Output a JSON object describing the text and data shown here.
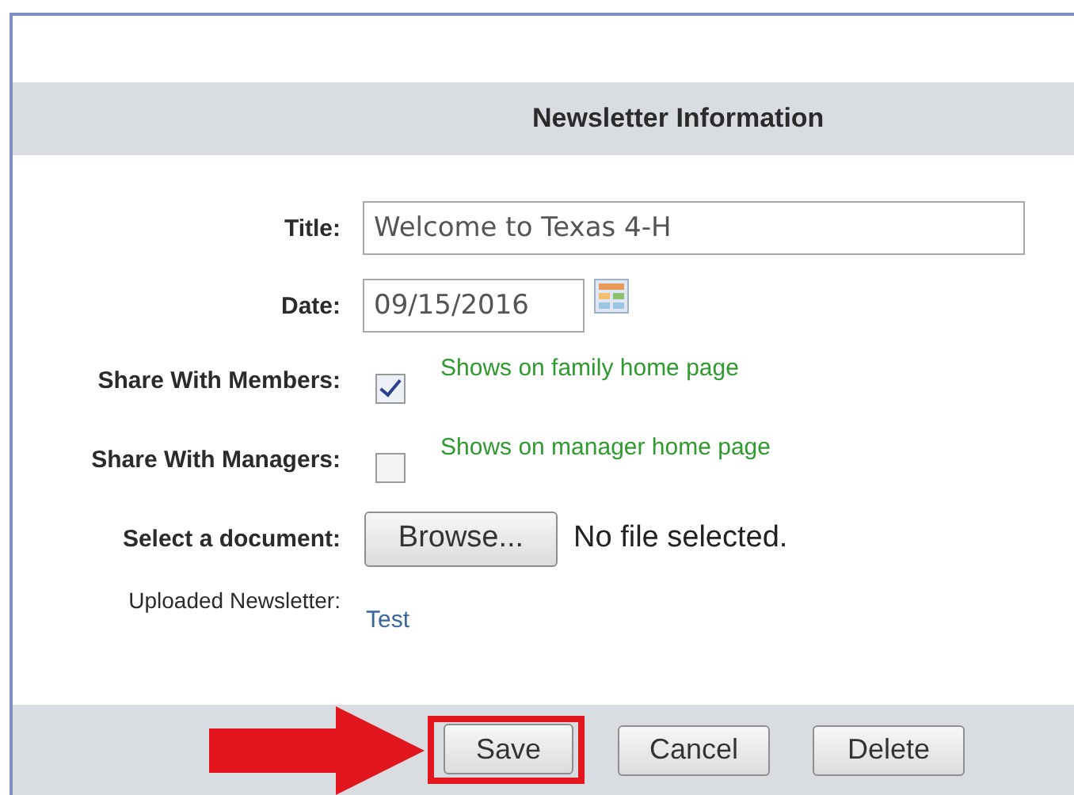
{
  "header": {
    "title": "Newsletter Information"
  },
  "fields": [
    {
      "kind": "text",
      "label": "Title:",
      "value": "Welcome to Texas 4-H"
    },
    {
      "kind": "date",
      "label": "Date:",
      "value": "09/15/2016"
    },
    {
      "kind": "checkbox",
      "label": "Share With Members:",
      "checked": true,
      "hint": "Shows on family home page"
    },
    {
      "kind": "checkbox",
      "label": "Share With Managers:",
      "checked": false,
      "hint": "Shows on manager home page"
    },
    {
      "kind": "file",
      "label": "Select a document:",
      "button": "Browse...",
      "status": "No file selected."
    },
    {
      "kind": "link",
      "label": "Uploaded Newsletter:",
      "link": "Test"
    }
  ],
  "buttons": [
    {
      "label": "Save",
      "highlighted": true
    },
    {
      "label": "Cancel",
      "highlighted": false
    },
    {
      "label": "Delete",
      "highlighted": false
    }
  ]
}
